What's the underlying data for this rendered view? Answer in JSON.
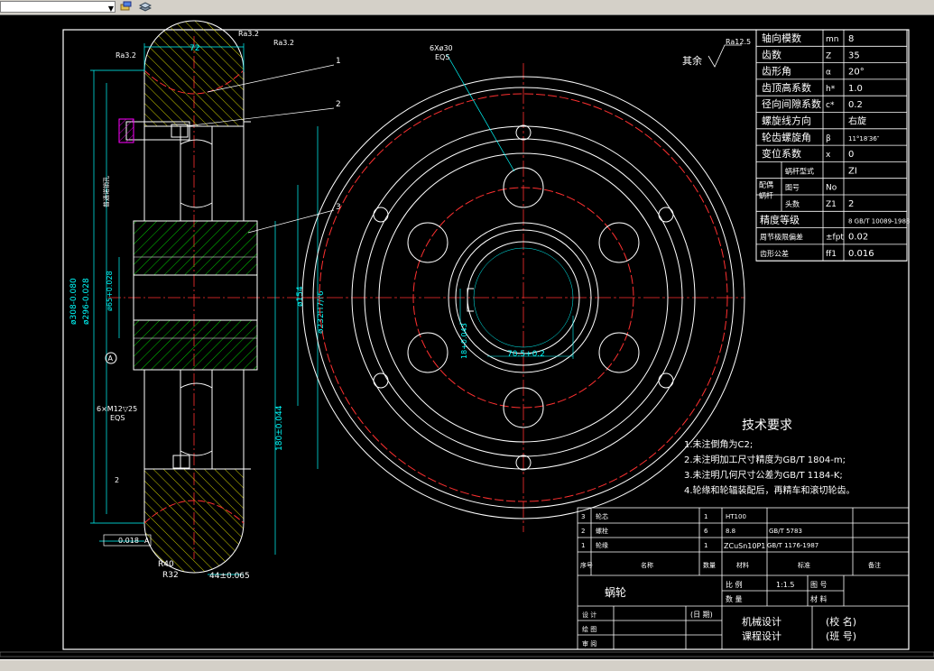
{
  "colors": {
    "line": "#ffffff",
    "dim": "#00ffff",
    "center": "#ff3030",
    "hatch": "#00ff00",
    "yellow": "#ffff00",
    "magenta": "#ff00ff"
  },
  "dims": {
    "width72": "72",
    "ra32a": "Ra3.2",
    "ra32b": "Ra3.2",
    "ra32c": "Ra3.2",
    "d308": "ø308-0.080",
    "d296": "ø296-0.028",
    "d65": "ø65+0.028",
    "d154": "ø154",
    "d232": "ø232H7/r6",
    "d180": "180±0.044",
    "m12": "6×M12▽25",
    "eqs1": "EQS",
    "two": "2",
    "tol": "0.018",
    "datumA": "A",
    "r40": "R40",
    "r32": "R32",
    "d44": "44±0.065",
    "tapmark": "普通诺销孔",
    "holes": "6Xø30",
    "eqs2": "EQS",
    "key18": "18+0.043",
    "key705": "70.5+0.2",
    "rest": "其余",
    "ra125": "Ra12.5"
  },
  "callouts": [
    "1",
    "2",
    "3"
  ],
  "params": [
    {
      "name": "轴向模数",
      "sym": "mn",
      "val": "8"
    },
    {
      "name": "齿数",
      "sym": "Z",
      "val": "35"
    },
    {
      "name": "齿形角",
      "sym": "α",
      "val": "20°"
    },
    {
      "name": "齿顶高系数",
      "sym": "h*",
      "val": "1.0"
    },
    {
      "name": "径向间隙系数",
      "sym": "c*",
      "val": "0.2"
    },
    {
      "name": "螺旋线方向",
      "sym": "",
      "val": "右旋"
    },
    {
      "name": "轮齿螺旋角",
      "sym": "β",
      "val": "11°18′36″"
    },
    {
      "name": "变位系数",
      "sym": "x",
      "val": "0"
    }
  ],
  "mate": {
    "group": "配偶蜗杆",
    "rows": [
      {
        "name": "蜗杆型式",
        "sym": "",
        "val": "ZI"
      },
      {
        "name": "图号",
        "sym": "No",
        "val": ""
      },
      {
        "name": "头数",
        "sym": "Z1",
        "val": "2"
      }
    ]
  },
  "accuracy": [
    {
      "name": "精度等级",
      "sym": "",
      "val": "8 GB/T 10089-1988"
    },
    {
      "name": "周节极限偏差",
      "sym": "±fpt",
      "val": "0.02"
    },
    {
      "name": "齿形公差",
      "sym": "ff1",
      "val": "0.016"
    }
  ],
  "tech": {
    "title": "技术要求",
    "items": [
      "1.未注倒角为C2;",
      "2.未注明加工尺寸精度为GB/T 1804-m;",
      "3.未注明几何尺寸公差为GB/T 1184-K;",
      "4.轮缘和轮辐装配后，再精车和滚切轮齿。"
    ]
  },
  "bom": [
    {
      "no": "3",
      "name": "轮芯",
      "qty": "1",
      "mat": "HT100",
      "std": ""
    },
    {
      "no": "2",
      "name": "螺栓",
      "qty": "6",
      "mat": "8.8",
      "std": "GB/T 5783"
    },
    {
      "no": "1",
      "name": "轮缘",
      "qty": "1",
      "mat": "ZCuSn10P1",
      "std": "GB/T 1176-1987"
    }
  ],
  "bomHead": {
    "no": "序号",
    "name": "名称",
    "qty": "数量",
    "mat": "材料",
    "std": "标准",
    "note": "备注"
  },
  "title": {
    "part": "蜗轮",
    "scaleLabel": "比 例",
    "scaleVal": "1:1.5",
    "drawNoLabel": "图 号",
    "qtyLabel": "数 量",
    "matLabel": "材 料",
    "design": "设 计",
    "draw": "绘 图",
    "check": "审 阅",
    "date": "(日 期)",
    "course1": "机械设计",
    "course2": "课程设计",
    "school": "(校 名)",
    "class": "(班 号)"
  }
}
